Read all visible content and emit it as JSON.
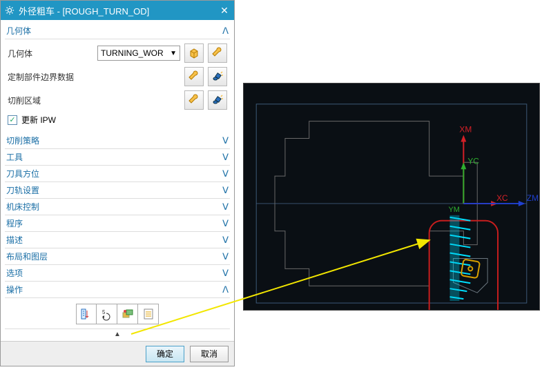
{
  "title": "外径粗车 - [ROUGH_TURN_OD]",
  "sections": {
    "geometry": {
      "label": "几何体"
    },
    "strategy": {
      "label": "切削策略"
    },
    "tool": {
      "label": "工具"
    },
    "tool_orient": {
      "label": "刀具方位"
    },
    "path_set": {
      "label": "刀轨设置"
    },
    "mc": {
      "label": "机床控制"
    },
    "prog": {
      "label": "程序"
    },
    "desc": {
      "label": "描述"
    },
    "layout": {
      "label": "布局和图层"
    },
    "options": {
      "label": "选项"
    },
    "ops": {
      "label": "操作"
    }
  },
  "geom": {
    "geom_label": "几何体",
    "geom_value": "TURNING_WOR",
    "custom_part": "定制部件边界数据",
    "cut_region": "切削区域",
    "update_ipw": "更新 IPW"
  },
  "footer": {
    "ok": "确定",
    "cancel": "取消"
  },
  "axes": {
    "xm": "XM",
    "yc": "YC",
    "ym": "YM",
    "xc": "XC",
    "zm": "ZM"
  }
}
